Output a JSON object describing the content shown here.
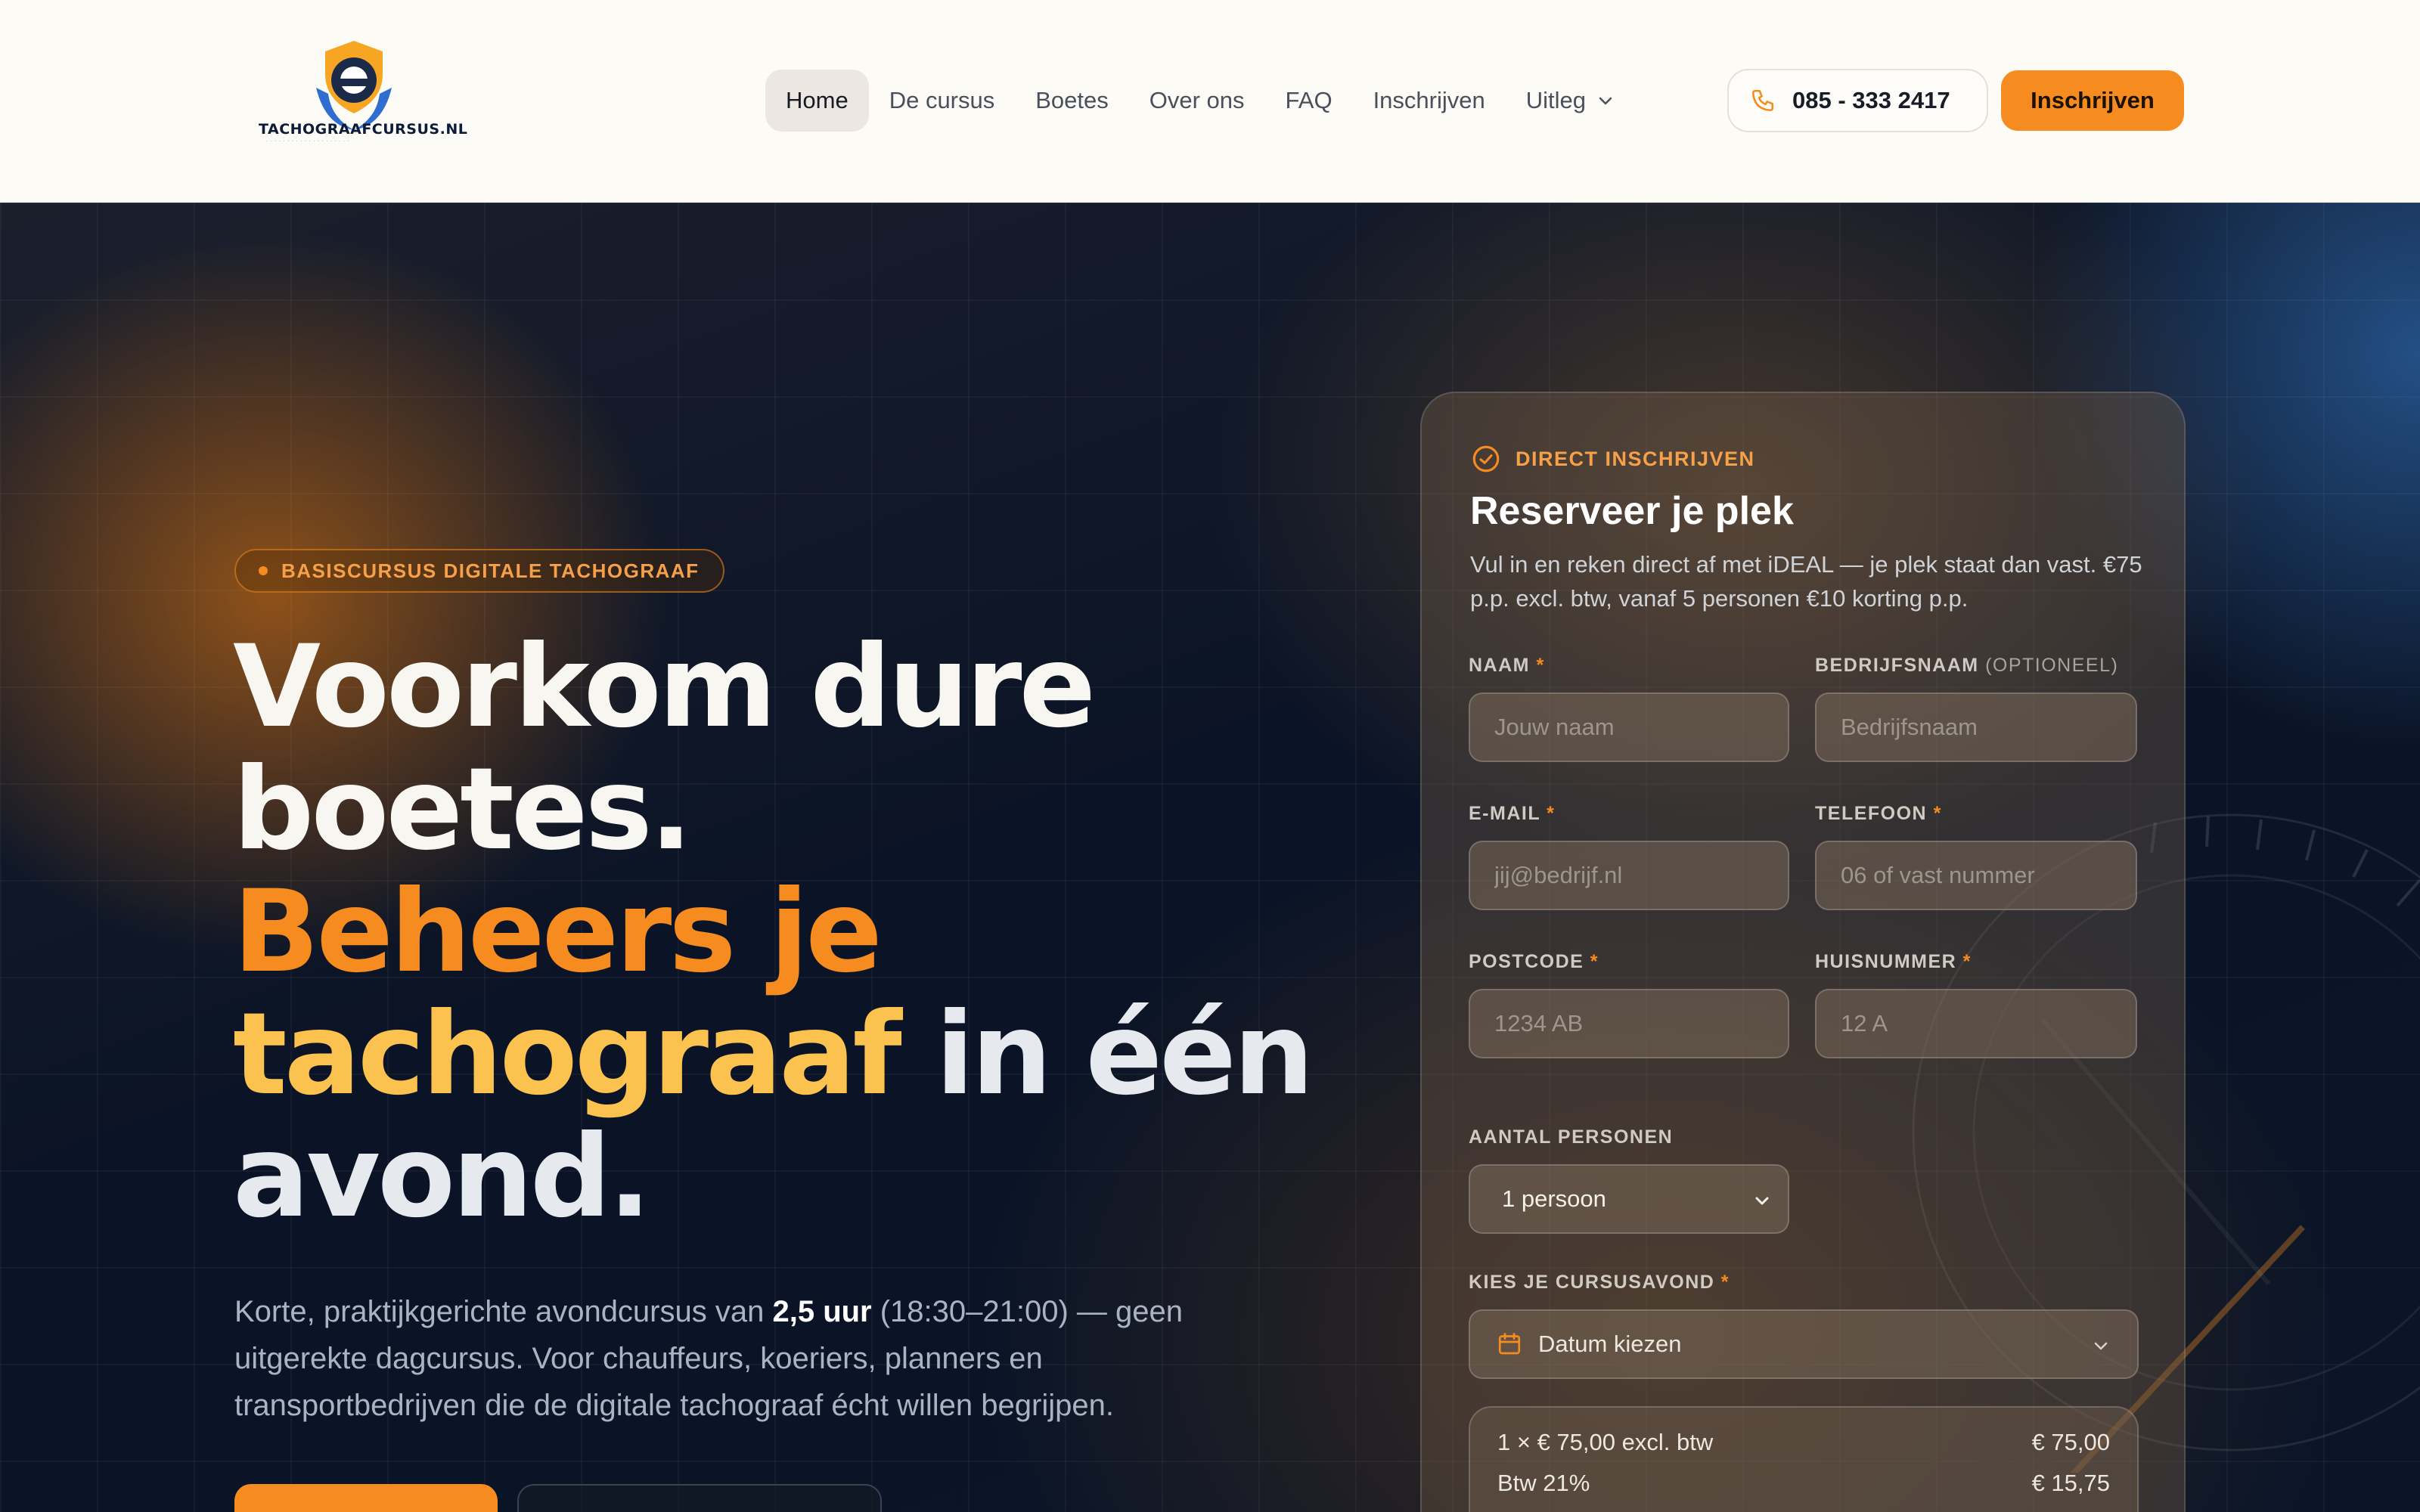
{
  "brand": {
    "logo_text": "TACHOGRAAFCURSUS.NL",
    "accent": "#f68b1f"
  },
  "nav": {
    "items": [
      {
        "label": "Home"
      },
      {
        "label": "De cursus"
      },
      {
        "label": "Boetes"
      },
      {
        "label": "Over ons"
      },
      {
        "label": "FAQ"
      },
      {
        "label": "Inschrijven"
      },
      {
        "label": "Uitleg"
      }
    ],
    "phone": "085 - 333 2417",
    "cta": "Inschrijven"
  },
  "hero": {
    "badge": "BASISCURSUS DIGITALE TACHOGRAAF",
    "headline": {
      "line1": "Voorkom dure",
      "line2": "boetes.",
      "line3": "Beheers je",
      "line4a": "tachograaf",
      "line4b": " in één",
      "line5": "avond."
    },
    "lead": {
      "part1": "Korte, praktijkgerichte avondcursus van ",
      "bold": "2,5 uur",
      "part2": " (18:30–21:00) — geen uitgerekte dagcursus. Voor chauffeurs, koeriers, planners en transportbedrijven die de digitale tachograaf écht willen begrijpen."
    }
  },
  "form": {
    "kicker": "DIRECT INSCHRIJVEN",
    "title": "Reserveer je plek",
    "subtitle": "Vul in en reken direct af met iDEAL — je plek staat dan vast. €75 p.p. excl. btw, vanaf 5 personen €10 korting p.p.",
    "fields": {
      "naam": {
        "label": "NAAM",
        "placeholder": "Jouw naam"
      },
      "bedrijf": {
        "label": "BEDRIJFSNAAM",
        "optional": "(OPTIONEEL)",
        "placeholder": "Bedrijfsnaam"
      },
      "email": {
        "label": "E-MAIL",
        "placeholder": "jij@bedrijf.nl"
      },
      "telefoon": {
        "label": "TELEFOON",
        "placeholder": "06 of vast nummer"
      },
      "postcode": {
        "label": "POSTCODE",
        "placeholder": "1234 AB"
      },
      "huisnummer": {
        "label": "HUISNUMMER",
        "placeholder": "12 A"
      }
    },
    "required_mark": "*",
    "personen": {
      "label": "AANTAL PERSONEN",
      "value": "1 persoon"
    },
    "avond": {
      "label": "KIES JE CURSUSAVOND",
      "value": "Datum kiezen"
    },
    "summary": [
      {
        "label": "1 × € 75,00 excl. btw",
        "amount": "€ 75,00"
      },
      {
        "label": "Btw 21%",
        "amount": "€ 15,75"
      }
    ]
  }
}
